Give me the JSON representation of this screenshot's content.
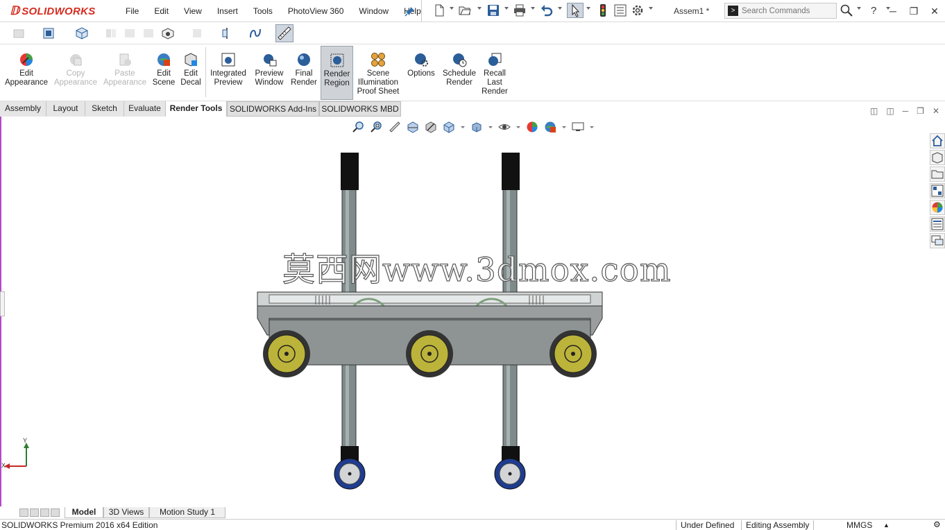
{
  "app": {
    "brand": "SOLIDWORKS",
    "brand_prefix": "3S",
    "document_title": "Assem1 *"
  },
  "menu": [
    "File",
    "Edit",
    "View",
    "Insert",
    "Tools",
    "PhotoView 360",
    "Window",
    "Help"
  ],
  "search": {
    "placeholder": "Search Commands"
  },
  "help_label": "?",
  "ribbon": {
    "buttons": [
      {
        "label1": "Edit",
        "label2": "Appearance",
        "label3": "",
        "icon": "appearance-icon",
        "state": "normal"
      },
      {
        "label1": "Copy",
        "label2": "Appearance",
        "label3": "",
        "icon": "copy-appearance-icon",
        "state": "disabled"
      },
      {
        "label1": "Paste",
        "label2": "Appearance",
        "label3": "",
        "icon": "paste-appearance-icon",
        "state": "disabled"
      },
      {
        "label1": "Edit",
        "label2": "Scene",
        "label3": "",
        "icon": "scene-icon",
        "state": "normal"
      },
      {
        "label1": "Edit",
        "label2": "Decal",
        "label3": "",
        "icon": "decal-icon",
        "state": "normal"
      },
      {
        "label1": "Integrated",
        "label2": "Preview",
        "label3": "",
        "icon": "integrated-preview-icon",
        "state": "normal"
      },
      {
        "label1": "Preview",
        "label2": "Window",
        "label3": "",
        "icon": "preview-window-icon",
        "state": "normal"
      },
      {
        "label1": "Final",
        "label2": "Render",
        "label3": "",
        "icon": "final-render-icon",
        "state": "normal"
      },
      {
        "label1": "Render",
        "label2": "Region",
        "label3": "",
        "icon": "render-region-icon",
        "state": "active"
      },
      {
        "label1": "Scene",
        "label2": "Illumination",
        "label3": "Proof Sheet",
        "icon": "illumination-icon",
        "state": "normal"
      },
      {
        "label1": "Options",
        "label2": "",
        "label3": "",
        "icon": "options-icon",
        "state": "normal"
      },
      {
        "label1": "Schedule",
        "label2": "Render",
        "label3": "",
        "icon": "schedule-render-icon",
        "state": "normal"
      },
      {
        "label1": "Recall",
        "label2": "Last",
        "label3": "Render",
        "icon": "recall-render-icon",
        "state": "normal"
      }
    ]
  },
  "command_tabs": [
    "Assembly",
    "Layout",
    "Sketch",
    "Evaluate",
    "Render Tools",
    "SOLIDWORKS Add-Ins",
    "SOLIDWORKS MBD"
  ],
  "active_command_tab": "Render Tools",
  "watermark": "莫西网www.3dmox.com",
  "triad": {
    "y_label": "Y",
    "x_label": "X"
  },
  "bottom_tabs": [
    "Model",
    "3D Views",
    "Motion Study 1"
  ],
  "active_bottom_tab": "Model",
  "status": {
    "edition": "SOLIDWORKS Premium 2016 x64 Edition",
    "definition": "Under Defined",
    "mode": "Editing Assembly",
    "units": "MMGS"
  },
  "colors": {
    "brand_red": "#d52b1e",
    "viewport_border": "#b44ac9",
    "wheel_yellow": "#bcb33a",
    "caster_blue": "#1f3c8f",
    "frame_gray": "#8e8e8e"
  }
}
